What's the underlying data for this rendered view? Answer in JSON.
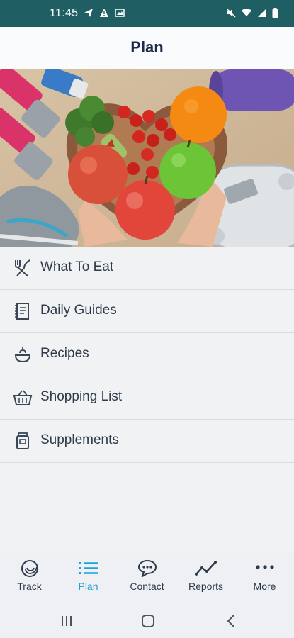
{
  "status_bar": {
    "time": "11:45",
    "left_icons": [
      "send-icon",
      "alert-icon",
      "image-icon"
    ],
    "right_icons": [
      "mute-icon",
      "wifi-icon",
      "signal-icon",
      "battery-icon"
    ]
  },
  "header": {
    "title": "Plan"
  },
  "hero": {
    "image_description": "heart-shaped bowl of fruits and vegetables with dumbbells, sneakers, yoga mat and scale"
  },
  "menu": {
    "items": [
      {
        "label": "What To Eat",
        "icon": "utensils-icon"
      },
      {
        "label": "Daily Guides",
        "icon": "document-icon"
      },
      {
        "label": "Recipes",
        "icon": "bowl-icon"
      },
      {
        "label": "Shopping List",
        "icon": "basket-icon"
      },
      {
        "label": "Supplements",
        "icon": "pill-bottle-icon"
      }
    ]
  },
  "tabbar": {
    "tabs": [
      {
        "label": "Track",
        "icon": "track-icon",
        "active": false
      },
      {
        "label": "Plan",
        "icon": "list-icon",
        "active": true
      },
      {
        "label": "Contact",
        "icon": "chat-icon",
        "active": false
      },
      {
        "label": "Reports",
        "icon": "line-chart-icon",
        "active": false
      },
      {
        "label": "More",
        "icon": "more-icon",
        "active": false
      }
    ]
  },
  "colors": {
    "status_bar": "#1f5f63",
    "accent": "#1aa3d9",
    "title": "#1d2a4a",
    "text": "#2f3b4a"
  },
  "system_nav": [
    "recents-button",
    "home-button",
    "back-button"
  ]
}
